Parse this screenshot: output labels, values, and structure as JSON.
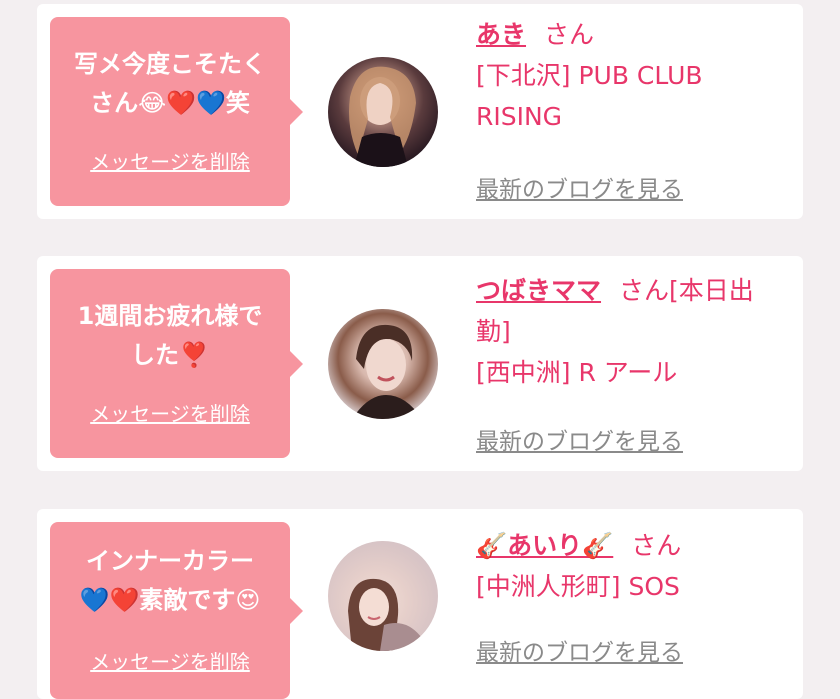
{
  "cards": [
    {
      "message": "写メ今度こそたく\nさん😂❤️💙笑",
      "delete_label": "メッセージを削除",
      "name": "あき",
      "suffix": "さん",
      "shop": "[下北沢] PUB CLUB RISING",
      "blog_label": "最新のブログを見る"
    },
    {
      "message": "1週間お疲れ様で\nした❣️",
      "delete_label": "メッセージを削除",
      "name": "つばきママ",
      "suffix": "さん[本日出勤]",
      "shop": "[西中洲] R アール",
      "blog_label": "最新のブログを見る"
    },
    {
      "message": "インナーカラー\n💙❤️素敵です😍",
      "delete_label": "メッセージを削除",
      "name": "🎸あいり🎸",
      "suffix": "さん",
      "shop": "[中洲人形町] SOS",
      "blog_label": "最新のブログを見る"
    }
  ],
  "colors": {
    "accent": "#e8366a",
    "bubble": "#f7959f",
    "link_gray": "#8a8a8a",
    "background": "#f3eff1"
  }
}
